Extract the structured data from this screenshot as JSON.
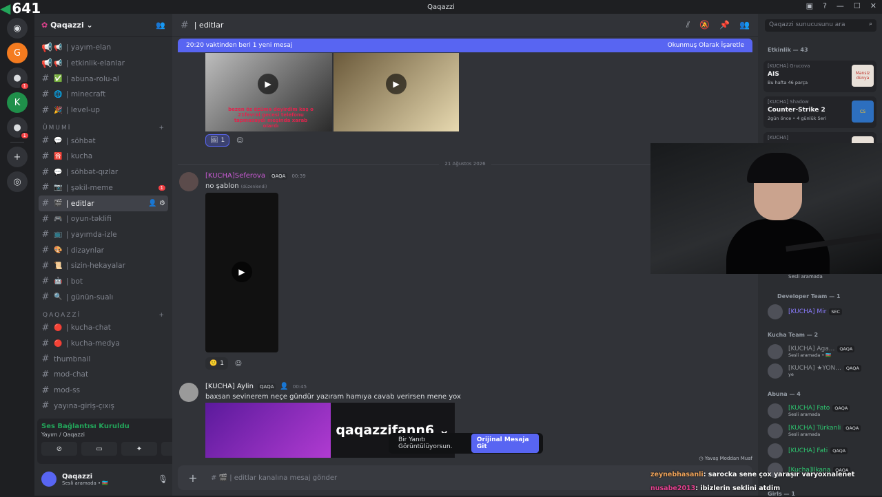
{
  "overlay_counter": "641",
  "window": {
    "title": "Qaqazzi"
  },
  "servers": [
    {
      "name": "discord-home",
      "glyph": "◉"
    },
    {
      "name": "server-g",
      "glyph": "G"
    },
    {
      "name": "server-avatar-1",
      "glyph": "●",
      "badge": "1"
    },
    {
      "name": "server-kucha",
      "glyph": "K"
    },
    {
      "name": "server-avatar-2",
      "glyph": "●",
      "badge": "1"
    },
    {
      "name": "add-server",
      "glyph": "+"
    },
    {
      "name": "discover",
      "glyph": "◎"
    }
  ],
  "guild": {
    "name": "Qaqazzi"
  },
  "channels_top": [
    {
      "emoji": "📢",
      "label": "| yayım-elan",
      "icon": "megaphone"
    },
    {
      "emoji": "📢",
      "label": "| etkinlik-elanlar",
      "icon": "megaphone"
    },
    {
      "emoji": "✅",
      "label": "| abuna-rolu-al"
    },
    {
      "emoji": "🌐",
      "label": "| minecraft"
    },
    {
      "emoji": "🎉",
      "label": "| level-up"
    }
  ],
  "category_umumi": "ÜMUMİ",
  "channels_umumi": [
    {
      "emoji": "💬",
      "label": "| söhbət"
    },
    {
      "emoji": "🈴",
      "label": "| kucha"
    },
    {
      "emoji": "💬",
      "label": "| söhbət-qızlar"
    },
    {
      "emoji": "📷",
      "label": "| şəkil-meme",
      "badge": "1"
    },
    {
      "emoji": "🎬",
      "label": "| editlar",
      "active": true
    },
    {
      "emoji": "🎮",
      "label": "| oyun-təklifi"
    },
    {
      "emoji": "📺",
      "label": "| yayımda-izle"
    },
    {
      "emoji": "🎨",
      "label": "| dizaynlar"
    },
    {
      "emoji": "📜",
      "label": "| sizin-hekayalar"
    },
    {
      "emoji": "🤖",
      "label": "| bot"
    },
    {
      "emoji": "🔍",
      "label": "| günün-sualı"
    }
  ],
  "category_qaqazzi": "QAQAZZİ",
  "channels_qaqazzi": [
    {
      "emoji": "🔴",
      "label": "| kucha-chat"
    },
    {
      "emoji": "🔴",
      "label": "| kucha-medya"
    },
    {
      "emoji": "",
      "label": "thumbnail"
    },
    {
      "emoji": "",
      "label": "mod-chat"
    },
    {
      "emoji": "",
      "label": "mod-ss"
    },
    {
      "emoji": "",
      "label": "yayına-giriş-çıxış"
    }
  ],
  "voice": {
    "status": "Ses Bağlantısı Kuruldu",
    "channel": "Yayım / Qaqazzi"
  },
  "user": {
    "name": "Qaqazzi",
    "status": "Sesli aramada • 🇦🇿"
  },
  "channel_header": {
    "name": "| editlar"
  },
  "new_messages": {
    "text": "20:20 vaktinden beri 1 yeni mesaj",
    "action": "Okunmuş Olarak İşaretle"
  },
  "media_caption": "bezen öz özümə deyirdim kaş o 21fevral gecesi telefonu tapmasaydı meşinda xarab olardı",
  "reaction_1": {
    "count": "1"
  },
  "date_divider": "21 Ağustos 2026",
  "message_1": {
    "author": "[KUCHA]Seferova",
    "tag": "QAQA",
    "time": "00:39",
    "text": "no şablon",
    "edited": "(düzenlendi)",
    "reaction_count": "1"
  },
  "message_2": {
    "author": "[KUCHA] Aylin",
    "tag": "QAQA",
    "time": "00:45",
    "text": "baxsan sevinerem neçe gündür yazıram hamıya cavab verirsen mene yox",
    "embed_text": "qaqazzifann6 ⌄"
  },
  "toast": {
    "text": "Bir Yanıtı Görüntülüyorsun.",
    "action": "Orijinal Mesaja Git"
  },
  "slowmode": "Yavaş Moddan Muaf",
  "composer": {
    "placeholder": "| editlar kanalına mesaj gönder"
  },
  "search": {
    "placeholder": "Qaqazzi sunucusunu ara"
  },
  "members": {
    "activity_header": "Etkinlik — 43",
    "cards": [
      {
        "who": "[KUCHA] Grucova",
        "title": "AIS",
        "sub": "Bu hafta 46 parça",
        "pic": "Mənsiz dünya"
      },
      {
        "who": "[KUCHA] Shadow",
        "title": "Counter-Strike 2",
        "sub": "2gün önce • 4 günlük Seri",
        "pic": "CS"
      },
      {
        "who": "[KUCHA]",
        "title": "",
        "sub": "",
        "pic": ""
      }
    ],
    "voice_line": "Sesli aramada",
    "dev_header": "Developer Team — 1",
    "dev": [
      {
        "name": "[KUCHA] Mir",
        "tag": "SEC"
      }
    ],
    "kucha_header": "Kucha Team — 2",
    "kucha": [
      {
        "name": "[KUCHA] Aga...",
        "tag": "QAQA",
        "sub": "Sesli aramada • 🇦🇿"
      },
      {
        "name": "[KUCHA] ★YON...",
        "tag": "QAQA",
        "sub": "ye"
      }
    ],
    "abuna_header": "Abuna — 4",
    "abuna": [
      {
        "name": "[KUCHA] Fato",
        "tag": "QAQA",
        "sub": "Sesli aramada"
      },
      {
        "name": "[KUCHA] Türkanli",
        "tag": "QAQA",
        "sub": "Sesli aramada"
      },
      {
        "name": "[KUCHA] Fati",
        "tag": "QAQA",
        "sub": ""
      },
      {
        "name": "[Kucha]Ilkana",
        "tag": "QAQA",
        "sub": ""
      }
    ],
    "girls_header": "Girls — 1"
  },
  "overlay_chat": [
    {
      "name": "zeynebhasanli",
      "text": ": sarocka sene çox yaraşır varyoxnalenet"
    },
    {
      "name": "nusabe2013",
      "text": ": ibizlerin seklini atdim"
    }
  ],
  "colors": {
    "accent": "#5865f2",
    "online": "#23a55a",
    "danger": "#f23f43",
    "seferova": "#c85ad3",
    "green_name": "#2dc770"
  }
}
